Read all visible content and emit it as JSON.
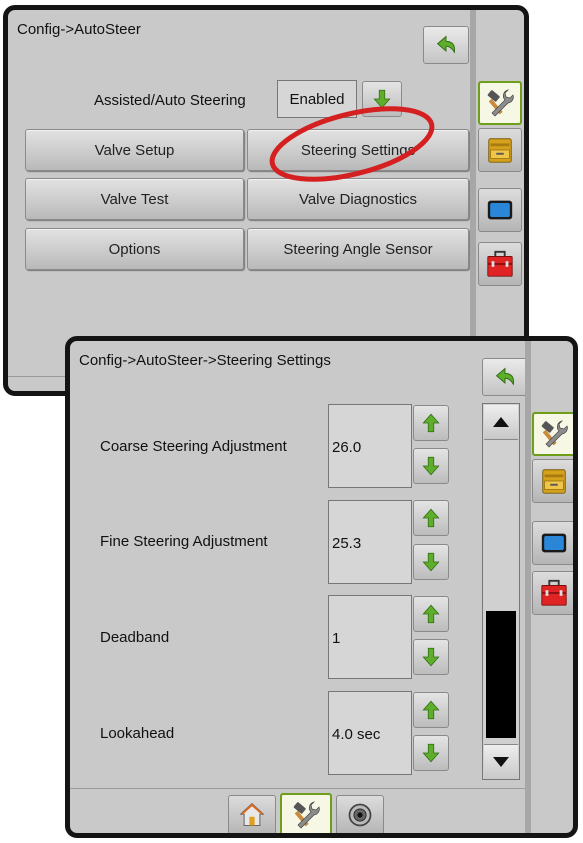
{
  "panel1": {
    "breadcrumb": "Config->AutoSteer",
    "assisted_label": "Assisted/Auto Steering",
    "assisted_value": "Enabled",
    "buttons": [
      "Valve Setup",
      "Steering Settings",
      "Valve Test",
      "Valve Diagnostics",
      "Options",
      "Steering Angle Sensor"
    ]
  },
  "panel2": {
    "breadcrumb": "Config->AutoSteer->Steering Settings",
    "settings": [
      {
        "label": "Coarse Steering Adjustment",
        "value": "26.0"
      },
      {
        "label": "Fine Steering Adjustment",
        "value": "25.3"
      },
      {
        "label": "Deadband",
        "value": "1"
      },
      {
        "label": "Lookahead",
        "value": "4.0 sec"
      }
    ]
  },
  "sidebar_icons": [
    "tools-icon",
    "drawer-icon",
    "display-icon",
    "toolbox-icon"
  ],
  "bottom_tabs": [
    "home-icon",
    "tools-icon",
    "camera-icon"
  ],
  "annotation": "red-circle-highlight",
  "colors": {
    "panel_bg": "#c9c9c9",
    "border": "#141414",
    "arrow_green": "#5fae2b",
    "highlight_red": "#d42020",
    "selected_border": "#6f9e1a"
  }
}
